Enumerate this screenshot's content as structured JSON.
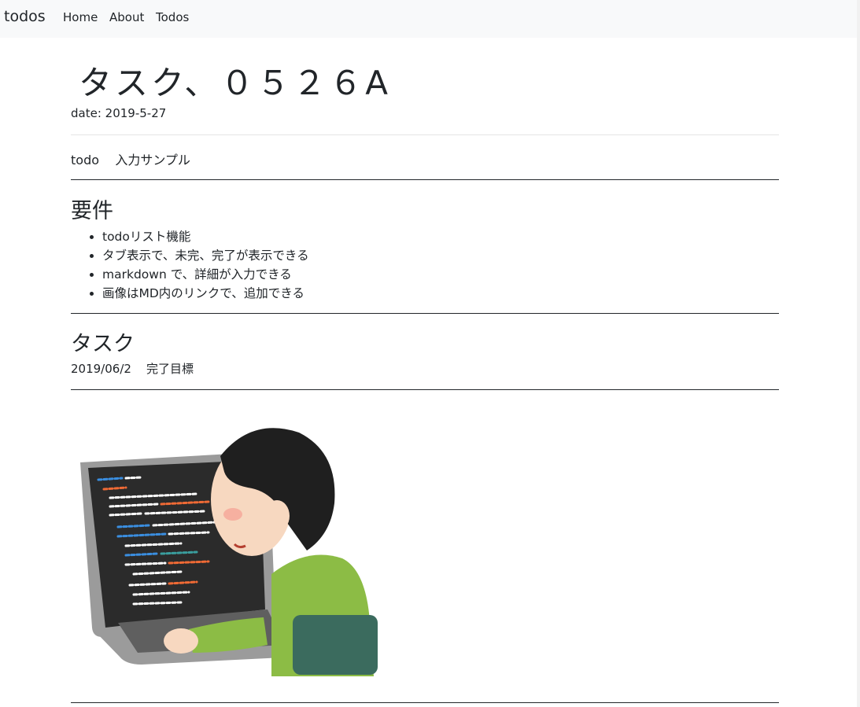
{
  "navbar": {
    "brand": "todos",
    "links": [
      "Home",
      "About",
      "Todos"
    ]
  },
  "article": {
    "title": "タスク、０５２６A",
    "date": "date:  2019-5-27",
    "intro": "todo    入力サンプル",
    "requirements_heading": "要件",
    "requirements": [
      "todoリスト機能",
      "タブ表示で、未完、完了が表示できる",
      "markdown で、詳細が入力できる",
      "画像はMD内のリンクで、追加できる"
    ],
    "task_heading": "タスク",
    "target": "2019/06/2    完了目標"
  },
  "illustration": {
    "name": "programmer-at-laptop"
  }
}
